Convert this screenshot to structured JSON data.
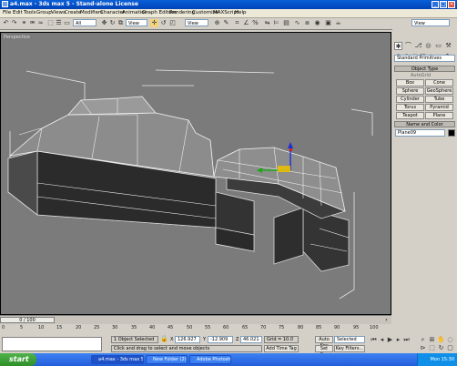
{
  "window": {
    "title": "a4.max - 3ds max 5 - Stand-alone License"
  },
  "menu": [
    "File",
    "Edit",
    "Tools",
    "Group",
    "Views",
    "Create",
    "Modifiers",
    "Character",
    "Animation",
    "Graph Editors",
    "Rendering",
    "Customize",
    "MAXScript",
    "Help"
  ],
  "toolbar": {
    "filter_value": "All",
    "ref_coord_value": "View",
    "view_dropdown": "View"
  },
  "viewport": {
    "label": "Perspective"
  },
  "command_panel": {
    "category_dropdown": "Standard Primitives",
    "object_type_header": "Object Type",
    "autogrid_label": "AutoGrid",
    "object_buttons": [
      "Box",
      "Cone",
      "Sphere",
      "GeoSphere",
      "Cylinder",
      "Tube",
      "Torus",
      "Pyramid",
      "Teapot",
      "Plane"
    ],
    "name_color_header": "Name and Color",
    "object_name": "Plane09",
    "object_color": "#000000"
  },
  "timeline": {
    "frame_display": "0 / 100",
    "ticks": [
      "0",
      "5",
      "10",
      "15",
      "20",
      "25",
      "30",
      "35",
      "40",
      "45",
      "50",
      "55",
      "60",
      "65",
      "70",
      "75",
      "80",
      "85",
      "90",
      "95",
      "100"
    ]
  },
  "status": {
    "selection": "1 Object Selected",
    "prompt": "Click and drag to select and move objects",
    "x_label": "X",
    "x_value": "126.927",
    "y_label": "Y",
    "y_value": "-12.909",
    "z_label": "Z",
    "z_value": "46.021",
    "grid": "Grid = 10.0",
    "add_time_tag": "Add Time Tag",
    "auto_key": "Auto Key",
    "set_key": "Set Key",
    "selected_value": "Selected",
    "key_filters": "Key Filters..."
  },
  "taskbar": {
    "start": "start",
    "tasks": [
      "a4.max - 3ds max 5 ...",
      "New Folder (2)",
      "Adobe Photoshop"
    ],
    "clock": "Mon 15:30"
  },
  "colors": {
    "viewport_bg": "#7b7b7b",
    "titlebar": "#0a5fd8",
    "taskbar": "#245edb",
    "start": "#3a9a34"
  }
}
